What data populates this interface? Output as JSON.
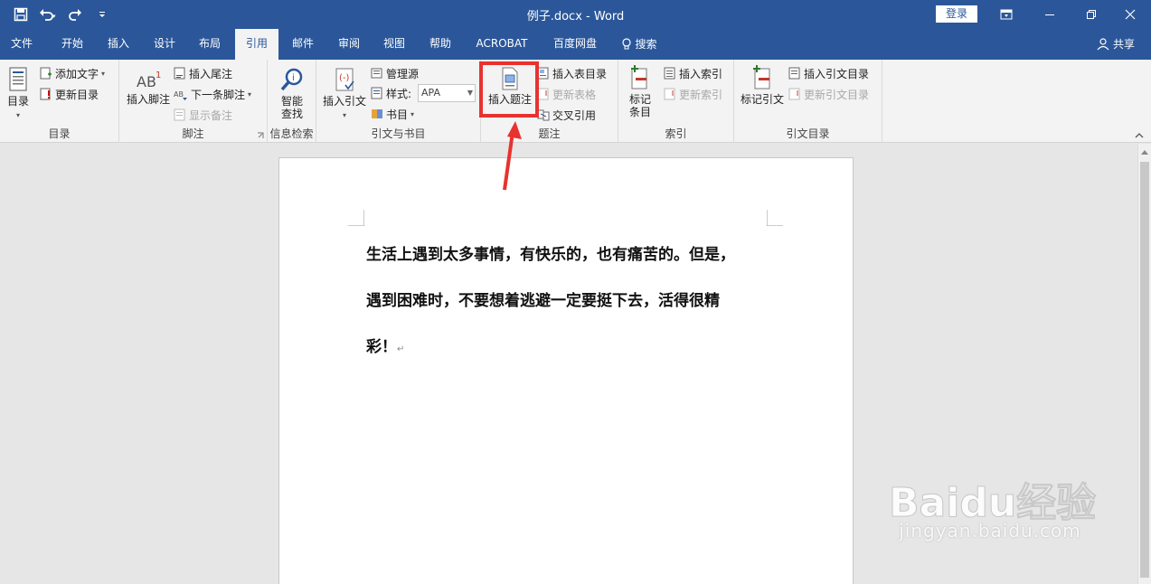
{
  "window": {
    "title": "例子.docx  -  Word",
    "login_label": "登录"
  },
  "tabs": [
    "文件",
    "开始",
    "插入",
    "设计",
    "布局",
    "引用",
    "邮件",
    "审阅",
    "视图",
    "帮助",
    "ACROBAT",
    "百度网盘",
    "搜索"
  ],
  "active_tab": "引用",
  "share_label": "共享",
  "ribbon": {
    "toc": {
      "big": "目录",
      "add_text": "添加文字",
      "update": "更新目录",
      "label": "目录"
    },
    "footnotes": {
      "insert_footnote": "插入脚注",
      "insert_endnote": "插入尾注",
      "next_footnote": "下一条脚注",
      "show_notes": "显示备注",
      "label": "脚注"
    },
    "research": {
      "smart_lookup_1": "智能",
      "smart_lookup_2": "查找",
      "label": "信息检索"
    },
    "citations": {
      "insert_citation": "插入引文",
      "manage_sources": "管理源",
      "style_label": "样式:",
      "style_value": "APA",
      "bibliography": "书目",
      "label": "引文与书目"
    },
    "captions": {
      "insert_caption": "插入题注",
      "insert_tof": "插入表目录",
      "update_table": "更新表格",
      "cross_ref": "交叉引用",
      "label": "题注"
    },
    "index": {
      "mark_entry_1": "标记",
      "mark_entry_2": "条目",
      "insert_index": "插入索引",
      "update_index": "更新索引",
      "label": "索引"
    },
    "toa": {
      "mark_citation": "标记引文",
      "insert_toa": "插入引文目录",
      "update_toa": "更新引文目录",
      "label": "引文目录"
    }
  },
  "document": {
    "lines": [
      "生活上遇到太多事情，有快乐的，也有痛苦的。但是，",
      "遇到困难时，不要想着逃避一定要挺下去，活得很精",
      "彩！"
    ]
  },
  "watermark": {
    "text": "jingyan.baidu.com",
    "brand": "Baidu经验"
  },
  "colors": {
    "accent": "#2b579a",
    "highlight": "#e8322f"
  }
}
